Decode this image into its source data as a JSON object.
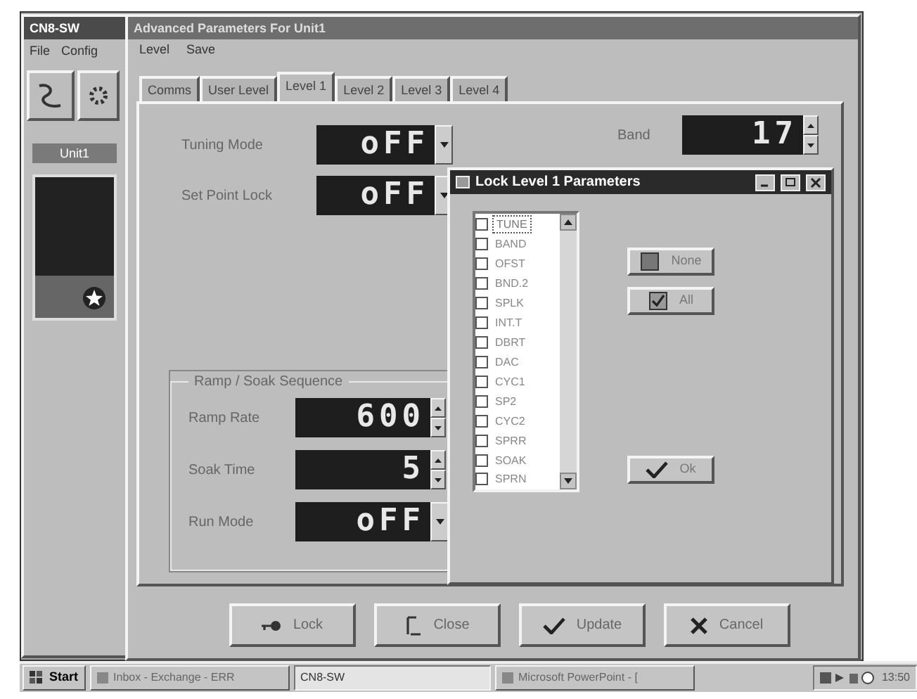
{
  "main_window": {
    "title": "CN8-SW",
    "menu": [
      "File",
      "Config"
    ],
    "unit_panel": {
      "title": "Unit1"
    }
  },
  "parameters_window": {
    "title": "Advanced Parameters For Unit1",
    "menu": [
      "Level",
      "Save"
    ],
    "tabs": [
      {
        "label": "Comms",
        "selected": false
      },
      {
        "label": "User Level",
        "selected": false
      },
      {
        "label": "Level 1",
        "selected": true
      },
      {
        "label": "Level 2",
        "selected": false
      },
      {
        "label": "Level 3",
        "selected": false
      },
      {
        "label": "Level 4",
        "selected": false
      }
    ],
    "fields": [
      {
        "label": "Tuning Mode",
        "value": "oFF",
        "kind": "dropdown"
      },
      {
        "label": "Set Point Lock",
        "value": "oFF",
        "kind": "dropdown"
      }
    ],
    "band": {
      "label": "Band",
      "value": "17",
      "kind": "spinner"
    },
    "group": {
      "title": "Ramp / Soak Sequence",
      "fields": [
        {
          "label": "Ramp Rate",
          "value": "600",
          "kind": "spinner"
        },
        {
          "label": "Soak Time",
          "value": "5",
          "kind": "spinner"
        },
        {
          "label": "Run Mode",
          "value": "oFF",
          "kind": "dropdown"
        }
      ]
    },
    "buttons": [
      {
        "label": "Lock"
      },
      {
        "label": "Close"
      },
      {
        "label": "Update"
      },
      {
        "label": "Cancel"
      }
    ]
  },
  "lock_dialog": {
    "title": "Lock Level 1 Parameters",
    "items": [
      {
        "label": "TUNE",
        "checked": false,
        "selected": true
      },
      {
        "label": "BAND",
        "checked": false,
        "selected": false
      },
      {
        "label": "OFST",
        "checked": false,
        "selected": false
      },
      {
        "label": "BND.2",
        "checked": false,
        "selected": false
      },
      {
        "label": "SPLK",
        "checked": false,
        "selected": false
      },
      {
        "label": "INT.T",
        "checked": false,
        "selected": false
      },
      {
        "label": "DBRT",
        "checked": false,
        "selected": false
      },
      {
        "label": "DAC",
        "checked": false,
        "selected": false
      },
      {
        "label": "CYC1",
        "checked": false,
        "selected": false
      },
      {
        "label": "SP2",
        "checked": false,
        "selected": false
      },
      {
        "label": "CYC2",
        "checked": false,
        "selected": false
      },
      {
        "label": "SPRR",
        "checked": false,
        "selected": false
      },
      {
        "label": "SOAK",
        "checked": false,
        "selected": false
      },
      {
        "label": "SPRN",
        "checked": false,
        "selected": false
      }
    ],
    "buttons": [
      {
        "label": "None"
      },
      {
        "label": "All"
      },
      {
        "label": "Ok"
      }
    ]
  },
  "taskbar": {
    "start": "Start",
    "tasks": [
      {
        "label": "Inbox - Exchange - ERR",
        "selected": false
      },
      {
        "label": "CN8-SW",
        "selected": true
      },
      {
        "label": "Microsoft PowerPoint - [",
        "selected": false
      }
    ],
    "clock": "13:50"
  }
}
